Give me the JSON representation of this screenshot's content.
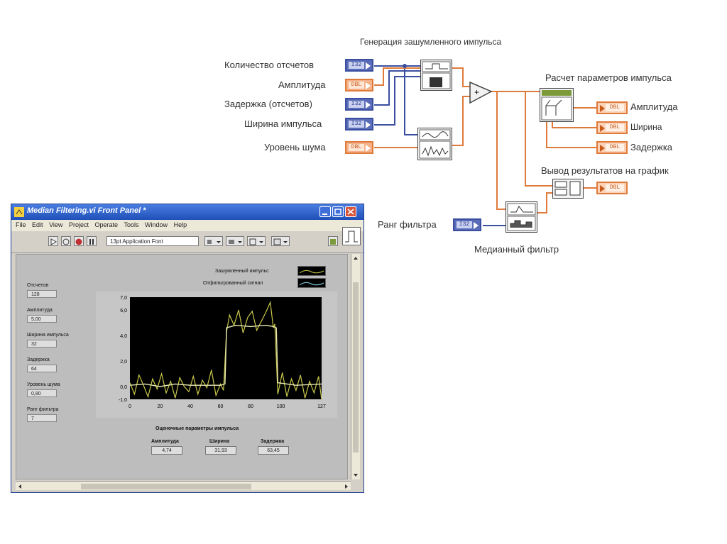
{
  "diagram": {
    "title_generation": "Генерация зашумленного импульса",
    "title_calc": "Расчет параметров импульса",
    "title_output": "Вывод результатов на график",
    "title_median": "Медианный фильтр",
    "inputs": [
      {
        "label": "Количество отсчетов",
        "type": "I32"
      },
      {
        "label": "Амплитуда",
        "type": "DBL"
      },
      {
        "label": "Задержка  (отсчетов)",
        "type": "I32"
      },
      {
        "label": "Ширина импульса",
        "type": "I32"
      },
      {
        "label": "Уровень шума",
        "type": "DBL"
      }
    ],
    "filter_rank": {
      "label": "Ранг фильтра",
      "type": "I32"
    },
    "outputs": [
      {
        "label": "Амплитуда",
        "type": "DBL"
      },
      {
        "label": "Ширина",
        "type": "DBL"
      },
      {
        "label": "Задержка",
        "type": "DBL"
      }
    ],
    "graph_out_type": "DBL",
    "wire_colors": {
      "int": "#3a4fa0",
      "dbl": "#e07a3a"
    }
  },
  "window": {
    "title": "Median Filtering.vi Front Panel *",
    "menu": [
      "File",
      "Edit",
      "View",
      "Project",
      "Operate",
      "Tools",
      "Window",
      "Help"
    ],
    "font_select": "13pt Application Font",
    "controls": [
      {
        "label": "Отсчетов",
        "value": "128"
      },
      {
        "label": "Амплитуда",
        "value": "5,00"
      },
      {
        "label": "Ширина импульса",
        "value": "32"
      },
      {
        "label": "Задержка",
        "value": "64"
      },
      {
        "label": "Уровень шума",
        "value": "0,80"
      },
      {
        "label": "Ранг фильтра",
        "value": "7"
      }
    ],
    "legend": [
      "Зашумленный импульс",
      "Отфильтрованный сигнал"
    ],
    "results_title": "Оценочные параметры импульса",
    "results": [
      {
        "label": "Амплитуда",
        "value": "4,74"
      },
      {
        "label": "Ширина",
        "value": "31,93"
      },
      {
        "label": "Задержка",
        "value": "63,45"
      }
    ]
  },
  "chart_data": {
    "type": "line",
    "title": "",
    "xlabel": "",
    "ylabel": "",
    "xlim": [
      0,
      127
    ],
    "ylim": [
      -1.0,
      7.0
    ],
    "x_ticks": [
      "0",
      "20",
      "40",
      "60",
      "80",
      "100",
      "127"
    ],
    "y_ticks": [
      "7,0",
      "6,0",
      "4,0",
      "2,0",
      "0,0",
      "-1,0"
    ],
    "series": [
      {
        "name": "Зашумленный импульс",
        "color": "#c8c84a",
        "x": [
          0,
          3,
          6,
          9,
          12,
          15,
          18,
          21,
          24,
          27,
          30,
          33,
          36,
          39,
          42,
          45,
          48,
          51,
          54,
          57,
          60,
          62,
          64,
          66,
          69,
          72,
          75,
          78,
          81,
          84,
          87,
          90,
          93,
          95,
          96,
          98,
          101,
          104,
          107,
          110,
          113,
          116,
          119,
          122,
          125,
          127
        ],
        "y": [
          0.3,
          -0.6,
          0.9,
          0.1,
          -0.8,
          0.6,
          -0.2,
          1.0,
          -0.5,
          0.4,
          -0.9,
          0.7,
          0.0,
          -0.4,
          0.8,
          -0.6,
          0.5,
          -0.1,
          1.3,
          -0.7,
          0.2,
          -0.3,
          4.3,
          5.6,
          4.8,
          6.0,
          4.2,
          5.4,
          5.9,
          4.4,
          5.1,
          5.8,
          6.6,
          4.6,
          4.9,
          -0.6,
          1.1,
          -0.8,
          0.6,
          -0.3,
          0.9,
          -0.9,
          0.4,
          -0.5,
          0.8,
          -1.0
        ]
      },
      {
        "name": "Отфильтрованный сигнал",
        "color": "#e8e8b0",
        "x": [
          0,
          10,
          20,
          30,
          40,
          50,
          60,
          63,
          64,
          70,
          80,
          90,
          95,
          97,
          98,
          110,
          127
        ],
        "y": [
          0.1,
          0.2,
          0.0,
          0.2,
          0.1,
          0.1,
          0.1,
          0.2,
          4.6,
          4.8,
          4.7,
          4.8,
          4.7,
          4.6,
          0.3,
          0.1,
          0.2
        ]
      }
    ]
  }
}
